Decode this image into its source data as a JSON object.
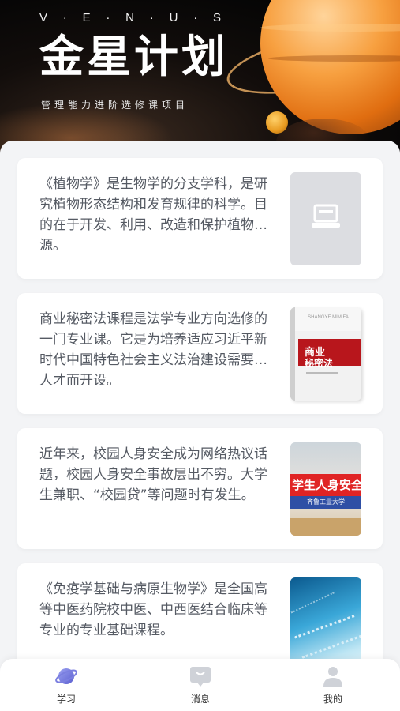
{
  "hero": {
    "letters": [
      "V",
      "E",
      "N",
      "U",
      "S"
    ],
    "title": "金星计划",
    "subtitle": "管理能力进阶选修课项目"
  },
  "courses": [
    {
      "description": "《植物学》是生物学的分支学科，是研究植物形态结构和发育规律的科学。目的在于开发、利用、改造和保护植物资源。",
      "thumbnail": "placeholder-image-icon"
    },
    {
      "description": "商业秘密法课程是法学专业方向选修的一门专业课。它是为培养适应习近平新时代中国特色社会主义法治建设需要的人才而开设。",
      "thumbnail": "book-cover",
      "cover_title_1": "商业",
      "cover_title_2": "秘密法",
      "cover_top_text": "SHANGYE MIMIFA"
    },
    {
      "description": "近年来，校园人身安全成为网络热议话题，校园人身安全事故层出不穷。大学生兼职、“校园贷”等问题时有发生。",
      "thumbnail": "safety-cover",
      "cover_banner": "学生人身安全",
      "cover_sub": "齐鲁工业大学"
    },
    {
      "description": "《免疫学基础与病原生物学》是全国高等中医药院校中医、中西医结合临床等专业的专业基础课程。",
      "thumbnail": "dna-cover"
    }
  ],
  "tabs": [
    {
      "label": "学习",
      "icon": "planet-icon",
      "active": true
    },
    {
      "label": "消息",
      "icon": "message-icon",
      "active": false
    },
    {
      "label": "我的",
      "icon": "user-icon",
      "active": false
    }
  ],
  "colors": {
    "accent": "#6b6fd6",
    "text": "#555a63",
    "background": "#f3f4f6"
  }
}
